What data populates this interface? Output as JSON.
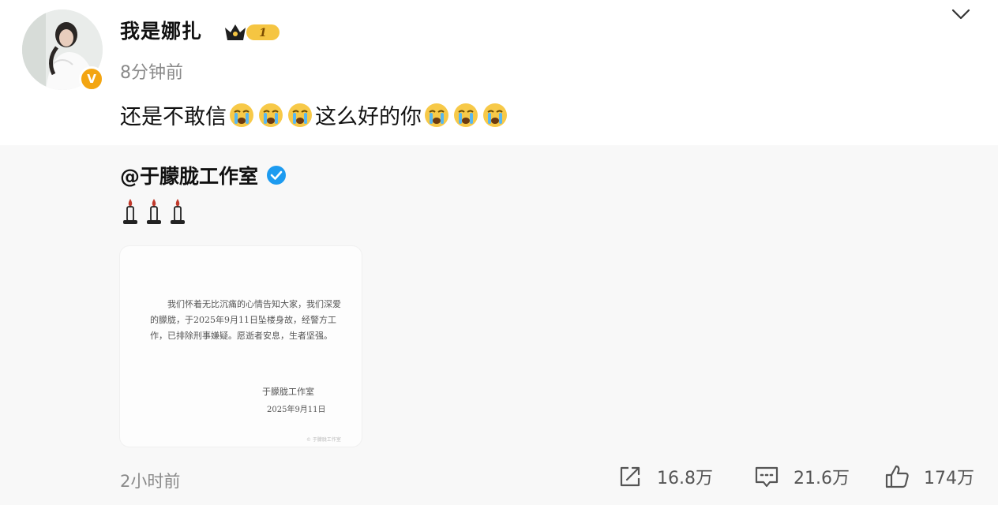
{
  "post": {
    "username": "我是娜扎",
    "vip_level": "1",
    "verified_badge": "V",
    "timestamp": "8分钟前",
    "text_before": "还是不敢信",
    "text_after": "这么好的你",
    "emoji": "crying-face-emoji"
  },
  "repost": {
    "author": "@于朦胧工作室",
    "notice_body": "我们怀着无比沉痛的心情告知大家，我们深爱的朦胧，于2025年9月11日坠楼身故，经警方工作，已排除刑事嫌疑。愿逝者安息，生者坚强。",
    "notice_signature": "于朦胧工作室",
    "notice_date": "2025年9月11日",
    "notice_watermark": "© 于朦胧工作室",
    "time": "2小时前"
  },
  "actions": {
    "share_count": "16.8万",
    "comment_count": "21.6万",
    "like_count": "174万"
  },
  "colors": {
    "repost_bg": "#f8f8f8",
    "verified_orange": "#f3a512",
    "verified_blue": "#1d9bf0",
    "muted_text": "#8a8a8a"
  }
}
